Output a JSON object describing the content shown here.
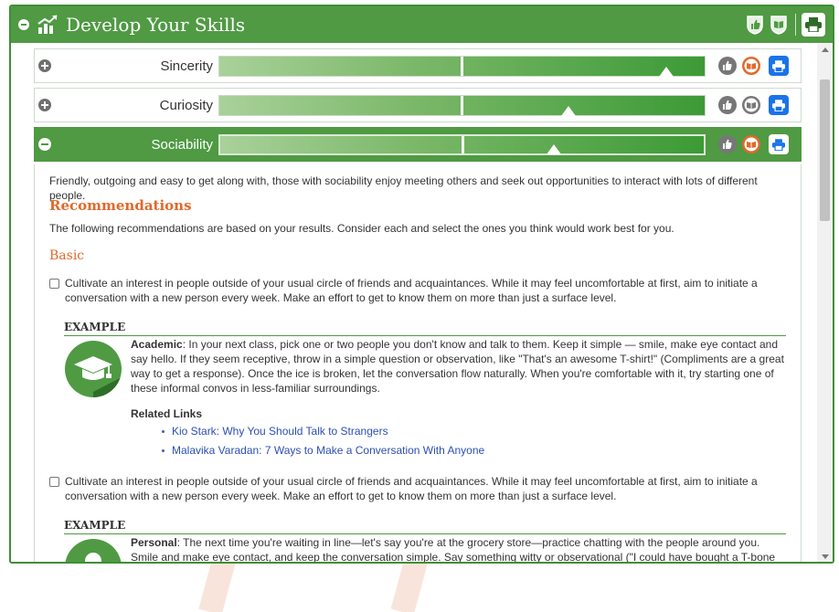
{
  "header": {
    "title": "Develop Your Skills",
    "icons": [
      "collapse-icon",
      "chart-growth-icon",
      "thumbs-up-badge-icon",
      "book-badge-icon",
      "print-icon"
    ]
  },
  "skills": [
    {
      "name": "Sincerity",
      "expanded": false,
      "level": 0.92
    },
    {
      "name": "Curiosity",
      "expanded": false,
      "level": 0.72
    },
    {
      "name": "Sociability",
      "expanded": true,
      "level": 0.69
    }
  ],
  "sociability": {
    "description": "Friendly, outgoing and easy to get along with, those with sociability enjoy meeting others and seek out opportunities to interact with lots of different people.",
    "recommendations_title": "Recommendations",
    "recommendations_intro": "The following recommendations are based on your results. Consider each and select the ones you think would work best for you.",
    "basic_label": "Basic",
    "items": [
      {
        "text": "Cultivate an interest in people outside of your usual circle of friends and acquaintances. While it may feel uncomfortable at first, aim to initiate a conversation with a new person every week. Make an effort to get to know them on more than just a surface level.",
        "example_label": "EXAMPLE",
        "example_kind": "Academic",
        "example_text": ": In your next class, pick one or two people you don't know and talk to them. Keep it simple — smile, make eye contact and say hello. If they seem receptive, throw in a simple question or observation, like \"That's an awesome T-shirt!\" (Compliments are a great way to get a response). Once the ice is broken, let the conversation flow naturally. When you're comfortable with it, try starting one of these informal convos in less-familiar surroundings.",
        "related_label": "Related Links",
        "links": [
          "Kio Stark: Why You Should Talk to Strangers",
          "Malavika Varadan: 7 Ways to Make a Conversation With Anyone"
        ]
      },
      {
        "text": "Cultivate an interest in people outside of your usual circle of friends and acquaintances. While it may feel uncomfortable at first, aim to initiate a conversation with a new person every week. Make an effort to get to know them on more than just a surface level.",
        "example_label": "EXAMPLE",
        "example_kind": "Personal",
        "example_text": ": The next time you're waiting in line—let's say you're at the grocery store—practice chatting with the people around you. Smile and make eye contact, and keep the conversation simple. Say something witty or observational (\"I could have bought a T-bone steak for what this"
      }
    ]
  },
  "colors": {
    "primary_green": "#4f9a43",
    "accent_orange": "#e0692b",
    "link_blue": "#2c4fb0",
    "print_blue": "#1a73e8"
  }
}
